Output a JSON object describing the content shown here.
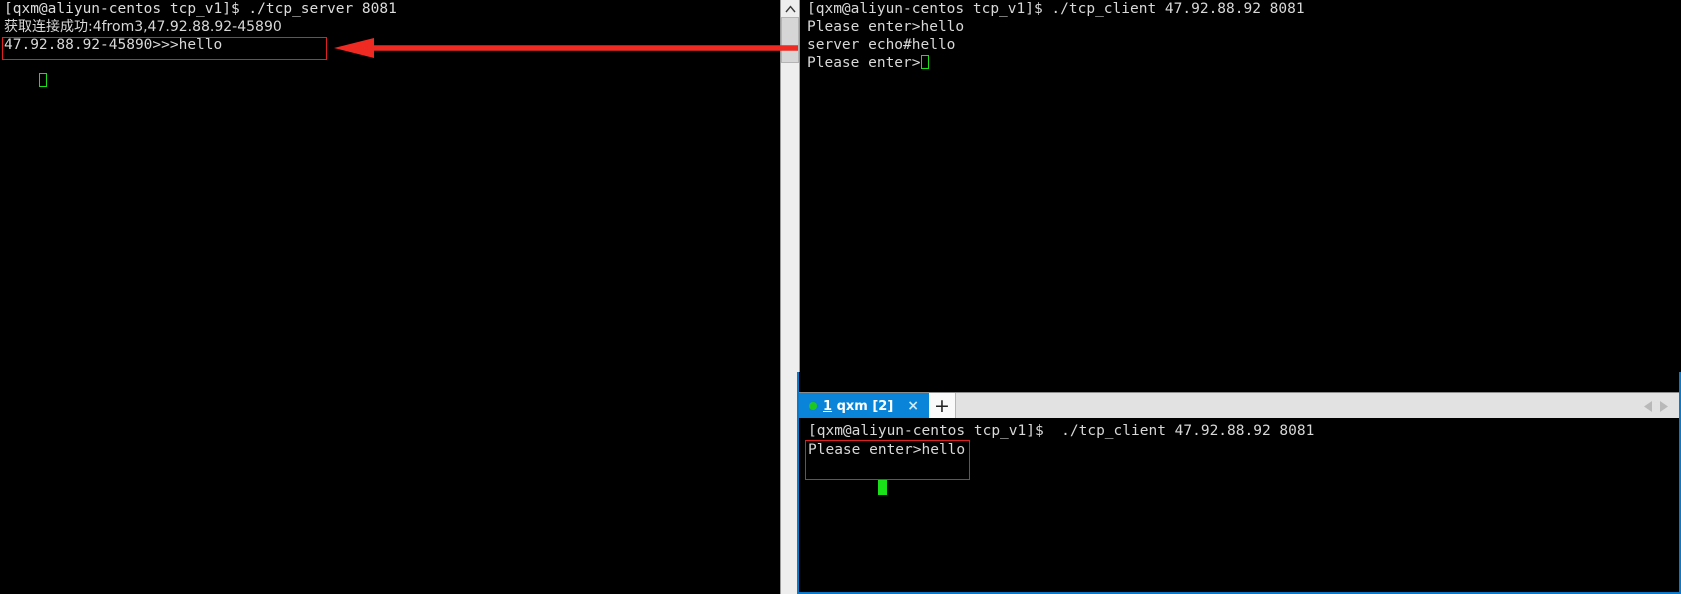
{
  "server_terminal": {
    "name": "tcp-server-terminal",
    "lines": [
      {
        "id": "server-cmd",
        "text": "[qxm@aliyun-centos tcp_v1]$ ./tcp_server 8081",
        "type": "command"
      },
      {
        "id": "server-accept",
        "text": "获取连接成功:4from3,47.92.88.92-45890",
        "type": "output-cjk"
      },
      {
        "id": "server-recv",
        "text": "47.92.88.92-45890>>>hello",
        "type": "output-highlighted"
      }
    ],
    "cursor": "block-hollow-green"
  },
  "client_terminal_top": {
    "name": "tcp-client-terminal-top",
    "lines": [
      {
        "id": "client-cmd",
        "text": "[qxm@aliyun-centos tcp_v1]$ ./tcp_client 47.92.88.92 8081",
        "type": "command"
      },
      {
        "id": "client-prompt-1",
        "text": "Please enter>hello",
        "type": "output"
      },
      {
        "id": "client-echo",
        "text": "server echo#hello",
        "type": "output-annotated"
      },
      {
        "id": "client-prompt-2",
        "text": "Please enter>",
        "type": "output-cursor"
      }
    ],
    "cursor": "block-hollow-green"
  },
  "scrollbar": {
    "up_arrow_icon": "chevron-up-icon"
  },
  "annotations": {
    "arrow": {
      "name": "red-arrow-annotation",
      "color": "#ee2a22",
      "direction": "left-to-right"
    },
    "server_box": {
      "name": "red-highlight-box-server",
      "color": "#e02020"
    },
    "bottom_box": {
      "name": "red-highlight-box-bottom",
      "color": "#e02020"
    }
  },
  "tabbed_window": {
    "name": "terminal-tab-window",
    "accent_color": "#0a84d8",
    "tabs": [
      {
        "id": "tab-1",
        "index": "1",
        "label": "qxm [2]",
        "full_label": "1 qxm [2]",
        "active": true,
        "status_dot_color": "#1ec81e",
        "close_label": "×"
      }
    ],
    "new_tab_label": "+",
    "scroll_left_icon": "triangle-left-icon",
    "scroll_right_icon": "triangle-right-icon"
  },
  "bottom_terminal": {
    "name": "tcp-client-terminal-bottom",
    "lines": [
      {
        "id": "bottom-cmd",
        "text": "[qxm@aliyun-centos tcp_v1]$  ./tcp_client 47.92.88.92 8081",
        "type": "command"
      },
      {
        "id": "bottom-prompt",
        "text": "Please enter>hello",
        "type": "output-highlighted"
      }
    ],
    "cursor": "block-solid-green"
  }
}
